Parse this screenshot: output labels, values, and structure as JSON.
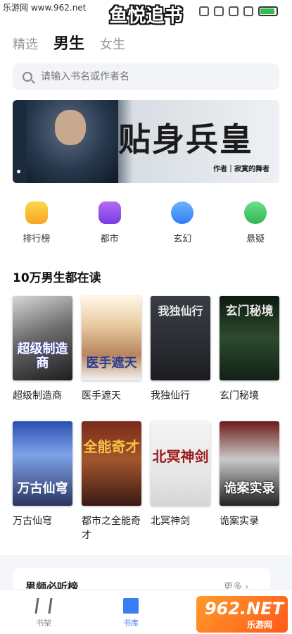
{
  "status_bar": {
    "watermark": "乐游网 www.962.net",
    "app_title": "鱼悦追书",
    "battery_level": 0.9
  },
  "tabs": [
    {
      "label": "精选",
      "active": false
    },
    {
      "label": "男生",
      "active": true
    },
    {
      "label": "女生",
      "active": false
    }
  ],
  "search": {
    "placeholder": "请输入书名或作者名"
  },
  "banner": {
    "title": "贴身兵皇",
    "author": "作者｜寂寞的舞者"
  },
  "categories": [
    {
      "label": "排行榜",
      "icon": "trophy-icon"
    },
    {
      "label": "都市",
      "icon": "city-icon"
    },
    {
      "label": "玄幻",
      "icon": "fantasy-icon"
    },
    {
      "label": "悬疑",
      "icon": "mystery-icon"
    }
  ],
  "section": {
    "title": "10万男生都在读"
  },
  "books": [
    {
      "title": "超级制造商",
      "cover_text": "超级制造商"
    },
    {
      "title": "医手遮天",
      "cover_text": "医手遮天"
    },
    {
      "title": "我独仙行",
      "cover_text": "我独仙行"
    },
    {
      "title": "玄门秘境",
      "cover_text": "玄门秘境"
    },
    {
      "title": "万古仙穹",
      "cover_text": "万古仙穹"
    },
    {
      "title": "都市之全能奇才",
      "cover_text": "全能奇才"
    },
    {
      "title": "北冥神剑",
      "cover_text": "北冥神剑"
    },
    {
      "title": "诡案实录",
      "cover_text": "诡案实录"
    }
  ],
  "next_section": {
    "title": "男频必听榜",
    "more": "更多 ›"
  },
  "bottom_nav": [
    {
      "label": "书架",
      "active": false
    },
    {
      "label": "书库",
      "active": true
    }
  ],
  "watermark_logo": {
    "brand": "962.NET",
    "sub": "乐游网"
  }
}
